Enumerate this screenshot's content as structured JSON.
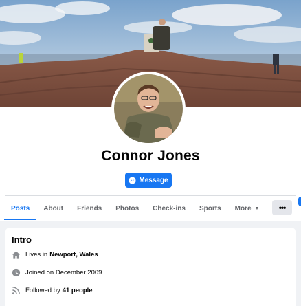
{
  "profile": {
    "name": "Connor Jones",
    "message_button": "Message"
  },
  "tabs": [
    {
      "label": "Posts",
      "active": true
    },
    {
      "label": "About"
    },
    {
      "label": "Friends"
    },
    {
      "label": "Photos"
    },
    {
      "label": "Check-ins"
    },
    {
      "label": "Sports"
    },
    {
      "label": "More"
    }
  ],
  "more_menu_icon": "ellipsis-icon",
  "intro": {
    "title": "Intro",
    "lives_prefix": "Lives in",
    "lives_place": "Newport, Wales",
    "joined": "Joined on December 2009",
    "followed_prefix": "Followed by",
    "followed_count": "41 people"
  },
  "colors": {
    "accent": "#1877f2",
    "page_bg": "#f0f2f5",
    "muted_text": "#65676b"
  }
}
